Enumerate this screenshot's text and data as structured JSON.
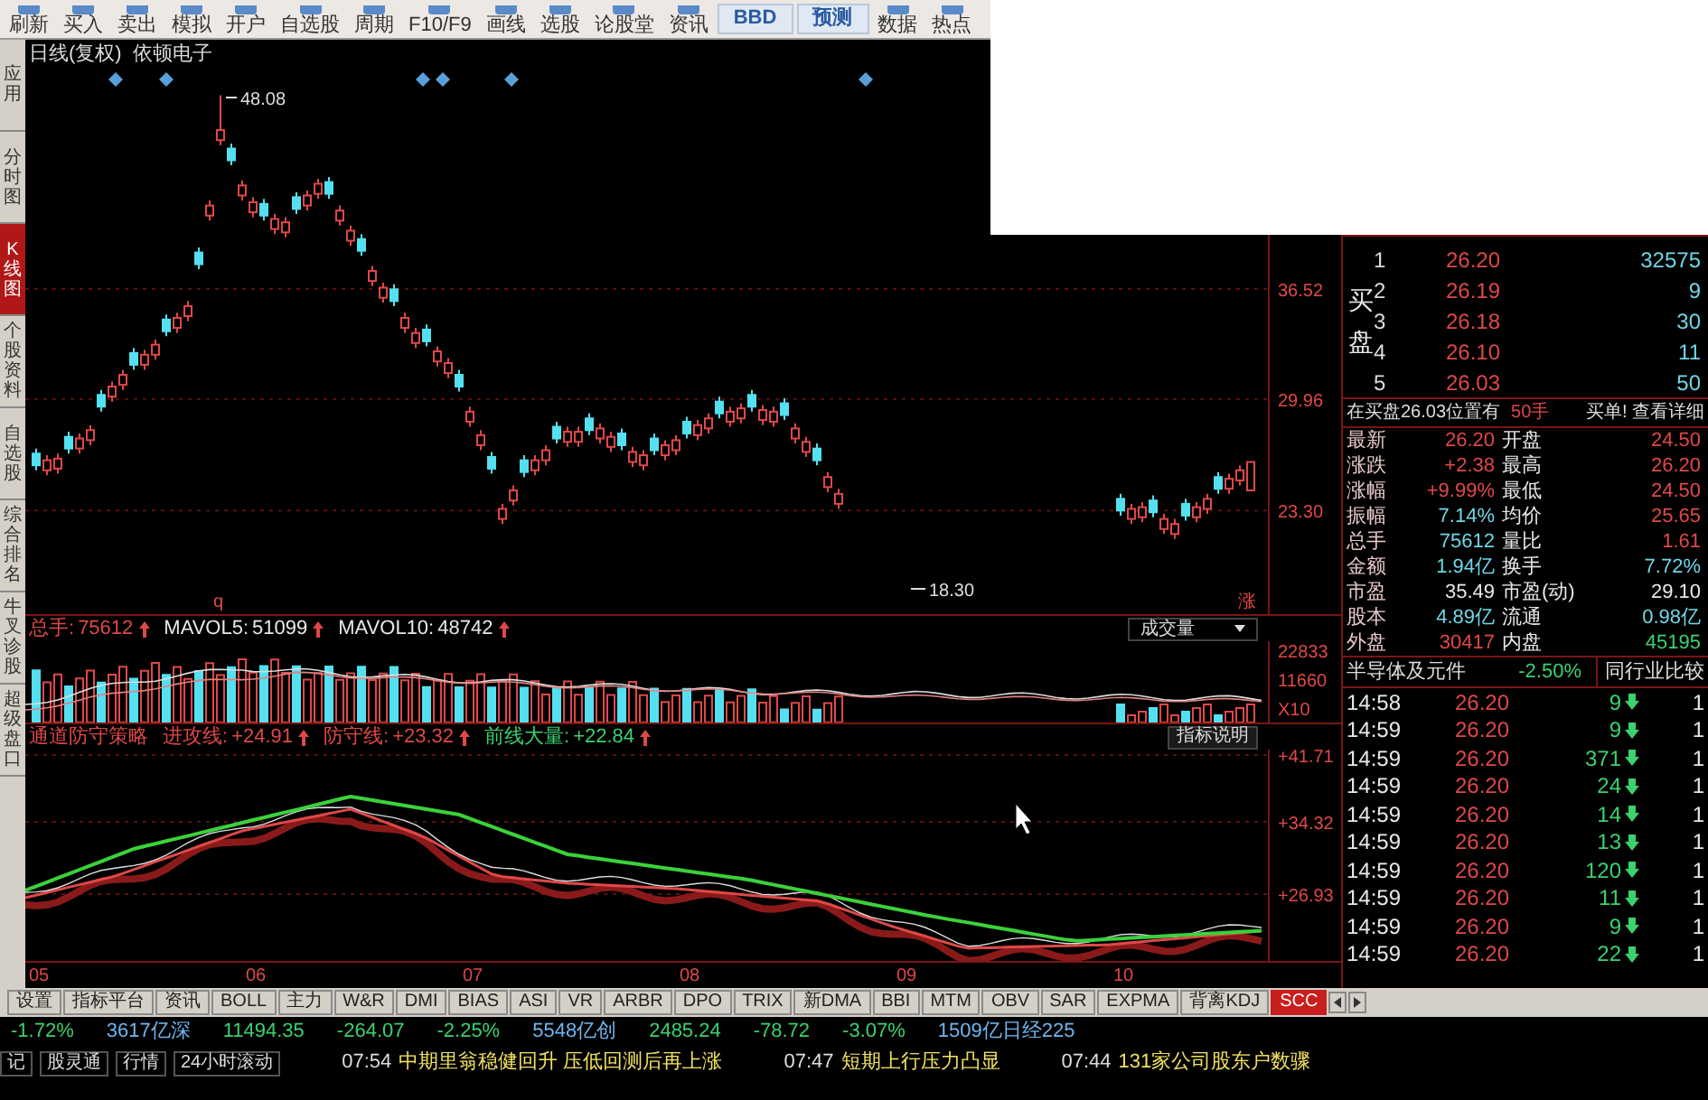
{
  "toolbar": [
    {
      "label": "刷新",
      "kind": "tool"
    },
    {
      "label": "买入",
      "kind": "tool"
    },
    {
      "label": "卖出",
      "kind": "tool"
    },
    {
      "label": "模拟",
      "kind": "tool"
    },
    {
      "label": "开户",
      "kind": "tool"
    },
    {
      "label": "自选股",
      "kind": "tool"
    },
    {
      "label": "周期",
      "kind": "tool"
    },
    {
      "label": "F10/F9",
      "kind": "tool"
    },
    {
      "label": "画线",
      "kind": "tool"
    },
    {
      "label": "选股",
      "kind": "tool"
    },
    {
      "label": "论股堂",
      "kind": "tool"
    },
    {
      "label": "资讯",
      "kind": "tool"
    },
    {
      "label": "BBD",
      "kind": "badge"
    },
    {
      "label": "预测",
      "kind": "badge"
    },
    {
      "label": "数据",
      "kind": "tool"
    },
    {
      "label": "热点",
      "kind": "tool"
    }
  ],
  "sidebar": [
    {
      "label": "应用",
      "selected": false
    },
    {
      "label": "分时图",
      "selected": false
    },
    {
      "label": "K线图",
      "selected": true
    },
    {
      "label": "个股资料",
      "selected": false
    },
    {
      "label": "自选股",
      "selected": false
    },
    {
      "label": "综合排名",
      "selected": false
    },
    {
      "label": "牛叉诊股",
      "selected": false
    },
    {
      "label": "超级盘口",
      "selected": false
    }
  ],
  "chart": {
    "period": "日线(复权)",
    "stock": "依顿电子",
    "high_label": "48.08",
    "low_label": "18.30",
    "left_mark": "q",
    "right_mark": "涨",
    "chart_data": {
      "type": "candlestick",
      "grid": true,
      "ylim": [
        17.12,
        49.67
      ],
      "yticks": [
        {
          "value": 36.52,
          "label": "36.52"
        },
        {
          "value": 29.96,
          "label": "29.96"
        },
        {
          "value": 23.3,
          "label": "23.30"
        }
      ],
      "ohlc": [
        [
          26.7,
          27.0,
          25.7,
          26.0
        ],
        [
          25.7,
          26.6,
          25.4,
          26.3
        ],
        [
          25.8,
          26.7,
          25.5,
          26.4
        ],
        [
          27.7,
          28.0,
          26.7,
          27.0
        ],
        [
          27.0,
          27.9,
          26.7,
          27.6
        ],
        [
          27.5,
          28.4,
          27.2,
          28.1
        ],
        [
          30.2,
          30.5,
          29.2,
          29.5
        ],
        [
          30.1,
          31.0,
          29.8,
          30.7
        ],
        [
          30.8,
          31.7,
          30.5,
          31.4
        ],
        [
          32.7,
          33.0,
          31.7,
          32.0
        ],
        [
          32.0,
          32.9,
          31.7,
          32.6
        ],
        [
          32.6,
          33.5,
          32.3,
          33.2
        ],
        [
          34.7,
          35.0,
          33.7,
          34.0
        ],
        [
          34.2,
          35.1,
          33.9,
          34.8
        ],
        [
          34.9,
          35.8,
          34.6,
          35.5
        ],
        [
          38.7,
          39.0,
          37.7,
          38.0
        ],
        [
          40.9,
          41.8,
          40.6,
          41.5
        ],
        [
          45.4,
          48.08,
          45.1,
          46.0
        ],
        [
          44.9,
          45.2,
          43.9,
          44.2
        ],
        [
          42.1,
          43.0,
          41.8,
          42.7
        ],
        [
          41.1,
          42.0,
          40.8,
          41.7
        ],
        [
          41.6,
          41.9,
          40.6,
          40.9
        ],
        [
          40.1,
          41.0,
          39.8,
          40.7
        ],
        [
          39.9,
          40.8,
          39.6,
          40.5
        ],
        [
          42.0,
          42.3,
          41.0,
          41.3
        ],
        [
          41.5,
          42.4,
          41.2,
          42.1
        ],
        [
          42.2,
          43.1,
          41.9,
          42.8
        ],
        [
          42.9,
          43.2,
          41.9,
          42.2
        ],
        [
          40.6,
          41.5,
          40.3,
          41.2
        ],
        [
          39.4,
          40.3,
          39.1,
          40.0
        ],
        [
          39.5,
          39.8,
          38.5,
          38.8
        ],
        [
          37.0,
          37.9,
          36.7,
          37.6
        ],
        [
          36.0,
          36.9,
          35.7,
          36.6
        ],
        [
          36.5,
          36.8,
          35.5,
          35.8
        ],
        [
          34.2,
          35.1,
          33.9,
          34.8
        ],
        [
          33.3,
          34.2,
          33.0,
          33.9
        ],
        [
          34.1,
          34.4,
          33.1,
          33.4
        ],
        [
          32.2,
          33.1,
          31.9,
          32.8
        ],
        [
          31.5,
          32.4,
          31.2,
          32.1
        ],
        [
          31.4,
          31.7,
          30.4,
          30.7
        ],
        [
          28.6,
          29.5,
          28.3,
          29.2
        ],
        [
          27.2,
          28.1,
          26.9,
          27.8
        ],
        [
          26.5,
          26.8,
          25.5,
          25.8
        ],
        [
          22.8,
          23.7,
          22.5,
          23.4
        ],
        [
          23.9,
          24.8,
          23.6,
          24.5
        ],
        [
          26.3,
          26.6,
          25.3,
          25.6
        ],
        [
          25.7,
          26.6,
          25.4,
          26.3
        ],
        [
          26.3,
          27.2,
          26.0,
          26.9
        ],
        [
          28.3,
          28.6,
          27.3,
          27.6
        ],
        [
          27.4,
          28.3,
          27.1,
          28.0
        ],
        [
          27.4,
          28.3,
          27.1,
          28.0
        ],
        [
          28.8,
          29.1,
          27.8,
          28.1
        ],
        [
          27.6,
          28.5,
          27.3,
          28.2
        ],
        [
          27.1,
          28.0,
          26.8,
          27.7
        ],
        [
          27.9,
          28.2,
          26.9,
          27.2
        ],
        [
          26.2,
          27.1,
          25.9,
          26.8
        ],
        [
          26.0,
          26.9,
          25.7,
          26.6
        ],
        [
          27.6,
          27.9,
          26.6,
          26.9
        ],
        [
          26.6,
          27.5,
          26.3,
          27.2
        ],
        [
          26.9,
          27.8,
          26.6,
          27.5
        ],
        [
          28.6,
          28.9,
          27.6,
          27.9
        ],
        [
          27.8,
          28.7,
          27.5,
          28.4
        ],
        [
          28.2,
          29.1,
          27.9,
          28.8
        ],
        [
          29.8,
          30.1,
          28.8,
          29.1
        ],
        [
          28.6,
          29.5,
          28.3,
          29.2
        ],
        [
          28.8,
          29.7,
          28.5,
          29.4
        ],
        [
          30.2,
          30.5,
          29.2,
          29.5
        ],
        [
          28.7,
          29.6,
          28.4,
          29.3
        ],
        [
          28.6,
          29.5,
          28.3,
          29.2
        ],
        [
          29.7,
          30.0,
          28.7,
          29.0
        ],
        [
          27.6,
          28.5,
          27.3,
          28.2
        ],
        [
          26.8,
          27.7,
          26.5,
          27.4
        ],
        [
          27.0,
          27.3,
          26.0,
          26.3
        ],
        [
          24.7,
          25.6,
          24.4,
          25.3
        ],
        [
          23.7,
          24.6,
          23.4,
          24.3
        ],
        null,
        null,
        null,
        null,
        null,
        null,
        null,
        null,
        null,
        null,
        null,
        null,
        null,
        null,
        null,
        null,
        null,
        null,
        null,
        null,
        null,
        null,
        null,
        null,
        null,
        [
          24.0,
          24.3,
          23.0,
          23.3
        ],
        [
          22.8,
          23.7,
          22.5,
          23.4
        ],
        [
          22.9,
          23.8,
          22.6,
          23.5
        ],
        [
          23.9,
          24.2,
          22.9,
          23.2
        ],
        [
          22.2,
          23.1,
          21.9,
          22.8
        ],
        [
          21.9,
          22.8,
          21.6,
          22.5
        ],
        [
          23.7,
          24.0,
          22.7,
          23.0
        ],
        [
          22.9,
          23.8,
          22.6,
          23.5
        ],
        [
          23.4,
          24.3,
          23.1,
          24.0
        ],
        [
          25.3,
          25.6,
          24.3,
          24.6
        ],
        [
          24.6,
          25.5,
          24.3,
          25.2
        ],
        [
          25.1,
          26.0,
          24.8,
          25.7
        ],
        [
          24.5,
          26.2,
          24.5,
          26.2
        ]
      ]
    }
  },
  "volume": {
    "fields": [
      {
        "label": "总手:",
        "value": "75612",
        "color": "#e04848"
      },
      {
        "label": "MAVOL5:",
        "value": "51099",
        "color": "#e8e8e8"
      },
      {
        "label": "MAVOL10:",
        "value": "48742",
        "color": "#e8e8e8"
      }
    ],
    "dropdown": "成交量",
    "ticks": [
      "22833",
      "11660",
      "X10"
    ]
  },
  "indicator": {
    "name": "通道防守策略",
    "fields": [
      {
        "label": "进攻线:",
        "value": "+24.91",
        "color": "#e04848"
      },
      {
        "label": "防守线:",
        "value": "+23.32",
        "color": "#e04848"
      },
      {
        "label": "前线大量:",
        "value": "+22.84",
        "color": "#3bd16f"
      }
    ],
    "button": "指标说明",
    "ticks": [
      "+41.71",
      "+34.32",
      "+26.93"
    ]
  },
  "x_labels": [
    "05",
    "06",
    "07",
    "08",
    "09",
    "10"
  ],
  "order_book": {
    "side_label": "买盘",
    "levels": [
      {
        "level": "1",
        "price": "26.20",
        "volume": "32575"
      },
      {
        "level": "2",
        "price": "26.19",
        "volume": "9"
      },
      {
        "level": "3",
        "price": "26.18",
        "volume": "30"
      },
      {
        "level": "4",
        "price": "26.10",
        "volume": "11"
      },
      {
        "level": "5",
        "price": "26.03",
        "volume": "50"
      }
    ],
    "note": "在买盘26.03位置有",
    "note_qty": "50手",
    "note_link": "买单! 查看详细"
  },
  "quote": [
    {
      "left": {
        "label": "最新",
        "value": "26.20",
        "color": "#e04848"
      },
      "right": {
        "label": "开盘",
        "value": "24.50",
        "color": "#e04848"
      }
    },
    {
      "left": {
        "label": "涨跌",
        "value": "+2.38",
        "color": "#e04848"
      },
      "right": {
        "label": "最高",
        "value": "26.20",
        "color": "#e04848"
      }
    },
    {
      "left": {
        "label": "涨幅",
        "value": "+9.99%",
        "color": "#e04848"
      },
      "right": {
        "label": "最低",
        "value": "24.50",
        "color": "#e04848"
      }
    },
    {
      "left": {
        "label": "振幅",
        "value": "7.14%",
        "color": "#6fd6e6"
      },
      "right": {
        "label": "均价",
        "value": "25.65",
        "color": "#e04848"
      }
    },
    {
      "left": {
        "label": "总手",
        "value": "75612",
        "color": "#6fd6e6"
      },
      "right": {
        "label": "量比",
        "value": "1.61",
        "color": "#e04848"
      }
    },
    {
      "left": {
        "label": "金额",
        "value": "1.94亿",
        "color": "#6fd6e6"
      },
      "right": {
        "label": "换手",
        "value": "7.72%",
        "color": "#6fd6e6"
      }
    },
    {
      "left": {
        "label": "市盈",
        "value": "35.49",
        "color": "#e8e8e8"
      },
      "right": {
        "label": "市盈(动)",
        "value": "29.10",
        "color": "#e8e8e8"
      }
    },
    {
      "left": {
        "label": "股本",
        "value": "4.89亿",
        "color": "#6fd6e6"
      },
      "right": {
        "label": "流通",
        "value": "0.98亿",
        "color": "#6fd6e6"
      }
    },
    {
      "left": {
        "label": "外盘",
        "value": "30417",
        "color": "#e04848"
      },
      "right": {
        "label": "内盘",
        "value": "45195",
        "color": "#3bd16f"
      }
    }
  ],
  "sector": {
    "name": "半导体及元件",
    "change": "-2.50%",
    "link": "同行业比较"
  },
  "trades": [
    {
      "time": "14:58",
      "price": "26.20",
      "volume": "9",
      "kind": "sell",
      "count": "1"
    },
    {
      "time": "14:59",
      "price": "26.20",
      "volume": "9",
      "kind": "sell",
      "count": "1"
    },
    {
      "time": "14:59",
      "price": "26.20",
      "volume": "371",
      "kind": "sell",
      "count": "1"
    },
    {
      "time": "14:59",
      "price": "26.20",
      "volume": "24",
      "kind": "sell",
      "count": "1"
    },
    {
      "time": "14:59",
      "price": "26.20",
      "volume": "14",
      "kind": "sell",
      "count": "1"
    },
    {
      "time": "14:59",
      "price": "26.20",
      "volume": "13",
      "kind": "sell",
      "count": "1"
    },
    {
      "time": "14:59",
      "price": "26.20",
      "volume": "120",
      "kind": "sell",
      "count": "1"
    },
    {
      "time": "14:59",
      "price": "26.20",
      "volume": "11",
      "kind": "sell",
      "count": "1"
    },
    {
      "time": "14:59",
      "price": "26.20",
      "volume": "9",
      "kind": "sell",
      "count": "1"
    },
    {
      "time": "14:59",
      "price": "26.20",
      "volume": "22",
      "kind": "sell",
      "count": "1"
    }
  ],
  "indicator_tabs": [
    {
      "label": "设置",
      "selected": false
    },
    {
      "label": "指标平台",
      "selected": false
    },
    {
      "label": "资讯",
      "selected": false
    },
    {
      "label": "BOLL",
      "selected": false
    },
    {
      "label": "主力",
      "selected": false
    },
    {
      "label": "W&R",
      "selected": false
    },
    {
      "label": "DMI",
      "selected": false
    },
    {
      "label": "BIAS",
      "selected": false
    },
    {
      "label": "ASI",
      "selected": false
    },
    {
      "label": "VR",
      "selected": false
    },
    {
      "label": "ARBR",
      "selected": false
    },
    {
      "label": "DPO",
      "selected": false
    },
    {
      "label": "TRIX",
      "selected": false
    },
    {
      "label": "新DMA",
      "selected": false
    },
    {
      "label": "BBI",
      "selected": false
    },
    {
      "label": "MTM",
      "selected": false
    },
    {
      "label": "OBV",
      "selected": false
    },
    {
      "label": "SAR",
      "selected": false
    },
    {
      "label": "EXPMA",
      "selected": false
    },
    {
      "label": "背离KDJ",
      "selected": false
    },
    {
      "label": "SCC",
      "selected": true
    }
  ],
  "market": [
    {
      "text": "-1.72%",
      "color": "#3bd16f"
    },
    {
      "text": "3617亿深",
      "color": "#6fb6f0"
    },
    {
      "text": "11494.35",
      "color": "#3bd16f"
    },
    {
      "text": "-264.07",
      "color": "#3bd16f"
    },
    {
      "text": "-2.25%",
      "color": "#3bd16f"
    },
    {
      "text": "5548亿创",
      "color": "#6fb6f0"
    },
    {
      "text": "2485.24",
      "color": "#3bd16f"
    },
    {
      "text": "-78.72",
      "color": "#3bd16f"
    },
    {
      "text": "-3.07%",
      "color": "#3bd16f"
    },
    {
      "text": "1509亿日经225",
      "color": "#6fb6f0"
    }
  ],
  "news": {
    "tabs": [
      "记",
      "股灵通",
      "行情",
      "24小时滚动"
    ],
    "items": [
      {
        "time": "07:54",
        "text": "中期里翁稳健回升 压低回测后再上涨"
      },
      {
        "time": "07:47",
        "text": "短期上行压力凸显"
      },
      {
        "time": "07:44",
        "text": "131家公司股东户数骤"
      }
    ]
  }
}
